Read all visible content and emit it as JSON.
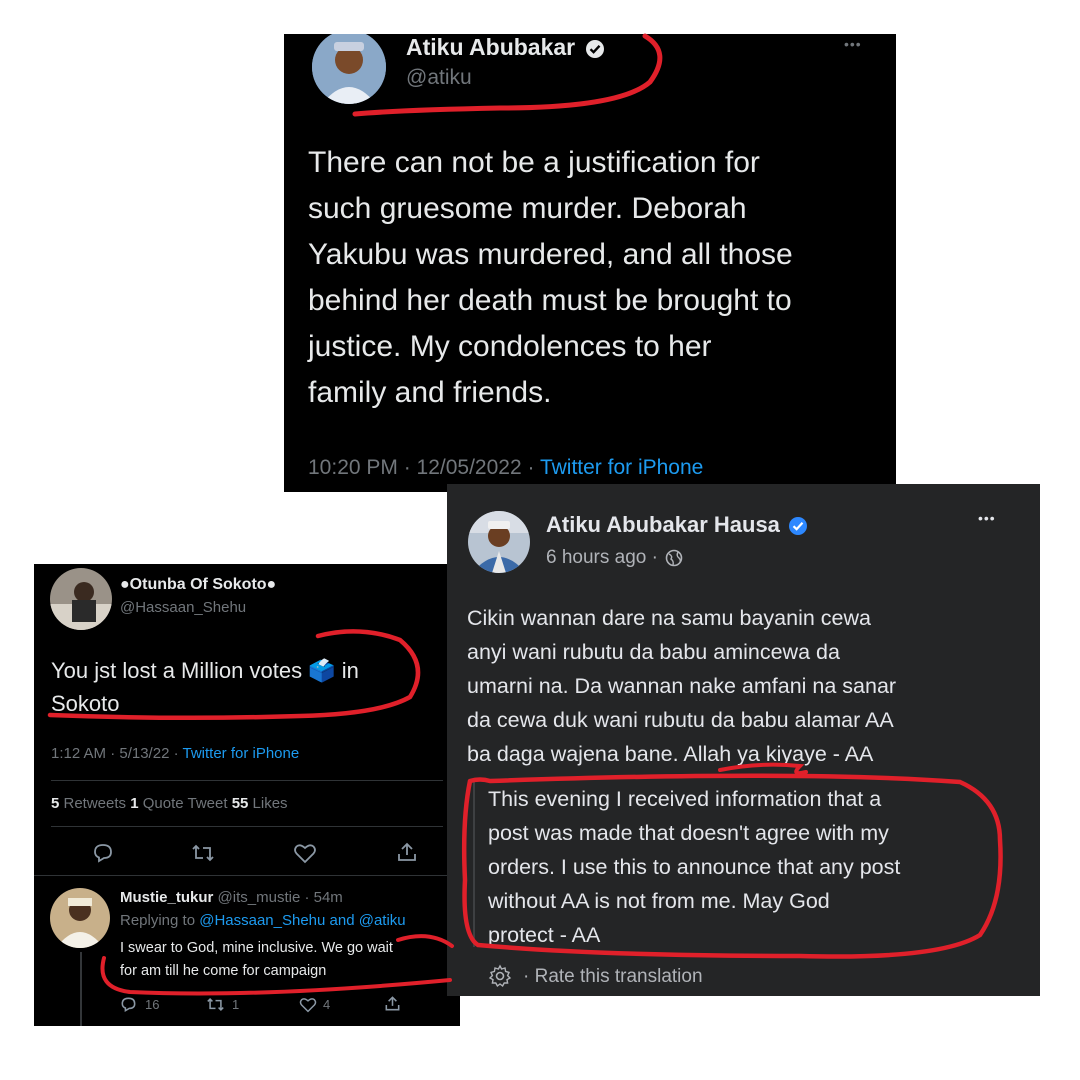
{
  "top_tweet": {
    "display_name": "Atiku Abubakar",
    "handle": "@atiku",
    "more_label": "•••",
    "lines": [
      "There can not be a justification for",
      "such gruesome murder. Deborah",
      "Yakubu was murdered, and all those",
      "behind her death must be brought to",
      "justice. My condolences to her",
      "family and friends."
    ],
    "time_date": "10:20 PM · 12/05/2022 · ",
    "source": "Twitter for iPhone"
  },
  "left_tweet": {
    "display_name": "Otunba Of Sokoto",
    "handle": "@Hassaan_Shehu",
    "line1_a": "You jst lost a Million votes ",
    "ballot_emoji": "🗳️",
    "line1_b": " in",
    "line2": "Sokoto",
    "time_date": "1:12 AM · 5/13/22 · ",
    "source": "Twitter for iPhone",
    "retweets_count": "5",
    "retweets_label": " Retweets ",
    "quotes_count": "1",
    "quotes_label": " Quote Tweet ",
    "likes_count": "55",
    "likes_label": " Likes"
  },
  "reply": {
    "display_name": "Mustie_tukur",
    "handle_time": "@its_mustie · 54m",
    "replying_prefix": "Replying to ",
    "replying_targets": "@Hassaan_Shehu and @atiku",
    "lines": [
      "I swear to God, mine inclusive. We go wait",
      "for am till he come for campaign"
    ],
    "reply_count": "16",
    "retweet_count": "1",
    "like_count": "4"
  },
  "fb_post": {
    "display_name": "Atiku Abubakar Hausa",
    "time": "6 hours ago ·",
    "more_label": "•••",
    "hausa_lines": [
      "Cikin wannan dare na samu bayanin cewa",
      "anyi wani rubutu da babu amincewa da",
      "umarni na. Da wannan nake amfani na sanar",
      "da cewa duk wani rubutu da babu alamar AA",
      "ba daga wajena bane. Allah ya kiyaye - AA"
    ],
    "translation_lines": [
      "This evening I received information that a",
      "post was made that doesn't agree with my",
      "orders. I use this to announce that any post",
      "without AA is not from me. May God",
      "protect - AA"
    ],
    "rate_label": "·  Rate this translation"
  },
  "colors": {
    "twitter_bg": "#000000",
    "facebook_bg": "#242526",
    "link_blue": "#1d9bf0",
    "verified_blue": "#2d88ff",
    "annotation_red": "#e0202a"
  }
}
